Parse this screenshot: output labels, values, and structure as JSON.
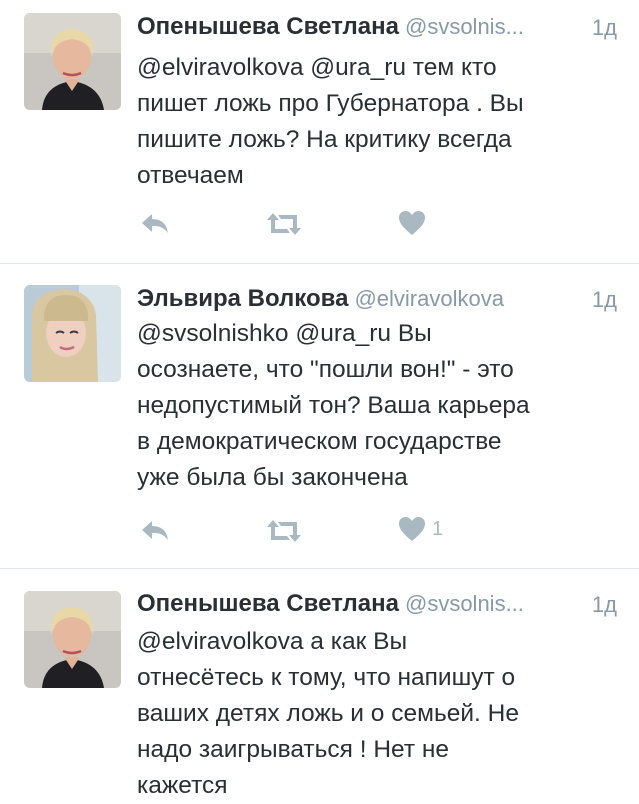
{
  "tweets": [
    {
      "name": "Опенышева Светлана",
      "handle": "@svsolnis...",
      "time": "1д",
      "text": "@elviravolkova @ura_ru тем кто\nпишет ложь про Губернатора . Вы\nпишите ложь? На критику всегда\nотвечаем",
      "likes": ""
    },
    {
      "name": "Эльвира Волкова",
      "handle": "@elviravolkova",
      "time": "1д",
      "text": "@svsolnishko @ura_ru Вы\nосознаете, что \"пошли вон!\" - это\nнедопустимый тон? Ваша карьера\nв демократическом государстве\nуже была бы закончена",
      "likes": "1"
    },
    {
      "name": "Опенышева Светлана",
      "handle": "@svsolnis...",
      "time": "1д",
      "text": "@elviravolkova а как Вы\nотнесётесь к тому, что напишут о\nваших детях ложь и о семьей. Не\nнадо заигрываться ! Нет не\nкажется",
      "likes": ""
    }
  ],
  "icons": {
    "reply": "reply-icon",
    "retweet": "retweet-icon",
    "like": "heart-icon"
  },
  "colors": {
    "action_icon": "#aab8c2",
    "secondary_text": "#8899a6",
    "divider": "#e1e8ed"
  }
}
